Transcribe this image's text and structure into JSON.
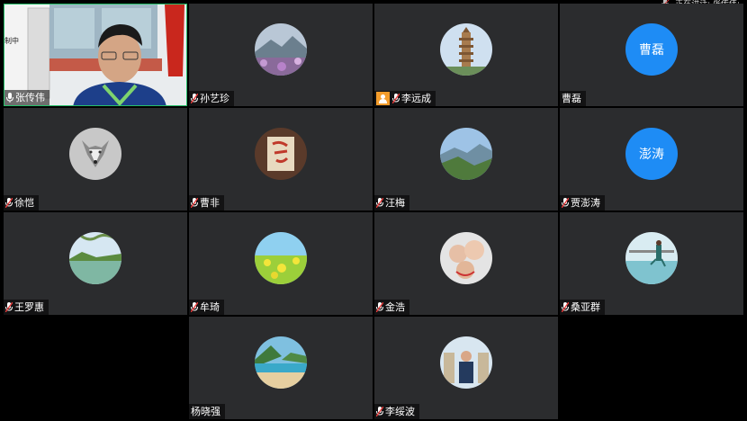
{
  "status": {
    "speaking": "正在讲话: 张传伟;"
  },
  "video_tile": {
    "name": "张传伟",
    "overlay_text": "制中"
  },
  "participants": [
    {
      "name": "孙艺珍",
      "avatar": "mountain-flowers"
    },
    {
      "name": "李远成",
      "avatar": "pagoda"
    },
    {
      "name": "曹磊",
      "avatar_text": "曹磊"
    },
    {
      "name": "徐恺",
      "avatar": "wolf"
    },
    {
      "name": "曹非",
      "avatar": "calligraphy"
    },
    {
      "name": "汪梅",
      "avatar": "valley"
    },
    {
      "name": "贾澎涛",
      "avatar_text": "澎涛"
    },
    {
      "name": "王罗惠",
      "avatar": "lake-tree"
    },
    {
      "name": "牟琦",
      "avatar": "rapeseed-field"
    },
    {
      "name": "金浩",
      "avatar": "family-selfie"
    },
    {
      "name": "桑亚群",
      "avatar": "seaside-person"
    },
    {
      "name": "杨晓强",
      "avatar": "beach-cove"
    },
    {
      "name": "李绥波",
      "avatar": "man-portrait"
    }
  ],
  "colors": {
    "accent": "#1e8cf5",
    "tile_bg": "#2b2c2e",
    "active_border": "#27c06a",
    "user_icon": "#f39c2b"
  }
}
